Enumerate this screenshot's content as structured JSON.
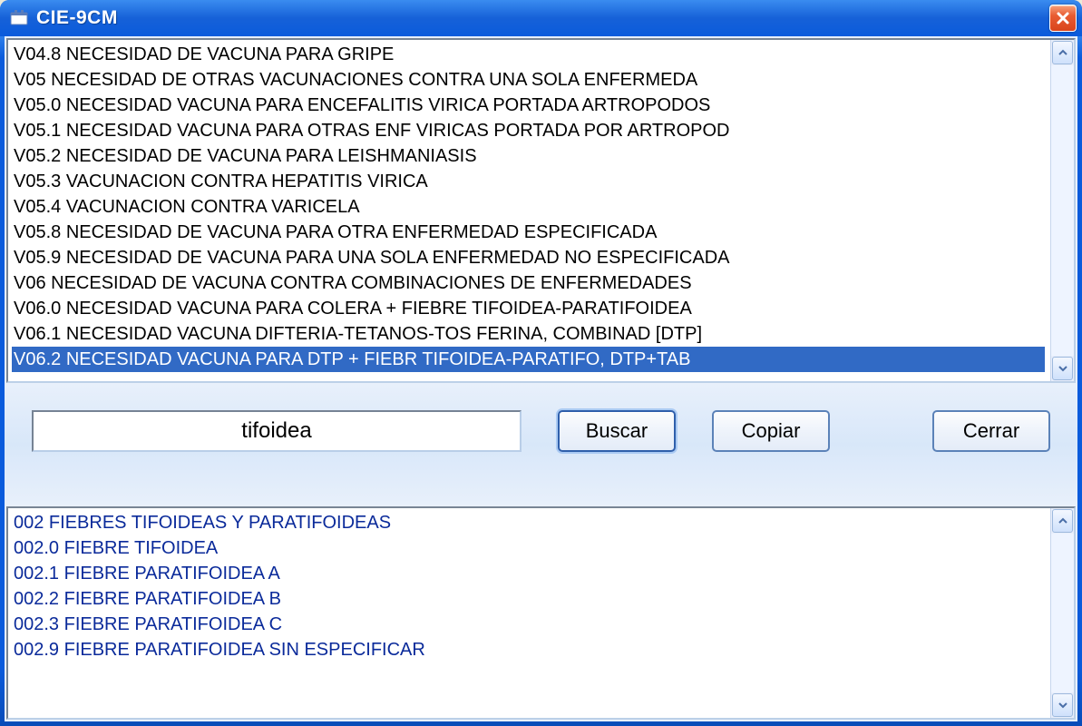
{
  "window": {
    "title": "CIE-9CM"
  },
  "topList": {
    "items": [
      {
        "text": "V04.8 NECESIDAD DE VACUNA PARA GRIPE",
        "selected": false
      },
      {
        "text": "V05 NECESIDAD DE OTRAS VACUNACIONES CONTRA UNA SOLA ENFERMEDA",
        "selected": false
      },
      {
        "text": "V05.0 NECESIDAD VACUNA PARA ENCEFALITIS VIRICA PORTADA ARTROPODOS",
        "selected": false
      },
      {
        "text": "V05.1 NECESIDAD VACUNA PARA OTRAS ENF VIRICAS PORTADA POR ARTROPOD",
        "selected": false
      },
      {
        "text": "V05.2 NECESIDAD DE VACUNA PARA LEISHMANIASIS",
        "selected": false
      },
      {
        "text": "V05.3 VACUNACION CONTRA HEPATITIS VIRICA",
        "selected": false
      },
      {
        "text": "V05.4 VACUNACION CONTRA VARICELA",
        "selected": false
      },
      {
        "text": "V05.8 NECESIDAD DE VACUNA PARA OTRA ENFERMEDAD ESPECIFICADA",
        "selected": false
      },
      {
        "text": "V05.9 NECESIDAD DE VACUNA PARA UNA SOLA ENFERMEDAD NO ESPECIFICADA",
        "selected": false
      },
      {
        "text": "V06 NECESIDAD DE VACUNA CONTRA COMBINACIONES DE ENFERMEDADES",
        "selected": false
      },
      {
        "text": "V06.0 NECESIDAD VACUNA PARA COLERA + FIEBRE TIFOIDEA-PARATIFOIDEA",
        "selected": false
      },
      {
        "text": "V06.1 NECESIDAD VACUNA DIFTERIA-TETANOS-TOS FERINA, COMBINAD [DTP]",
        "selected": false
      },
      {
        "text": "V06.2 NECESIDAD VACUNA PARA DTP + FIEBR TIFOIDEA-PARATIFO, DTP+TAB",
        "selected": true
      }
    ]
  },
  "search": {
    "value": "tifoidea"
  },
  "buttons": {
    "search": "Buscar",
    "copy": "Copiar",
    "close": "Cerrar"
  },
  "bottomList": {
    "items": [
      {
        "text": "002 FIEBRES TIFOIDEAS Y PARATIFOIDEAS"
      },
      {
        "text": "002.0 FIEBRE TIFOIDEA"
      },
      {
        "text": "002.1 FIEBRE PARATIFOIDEA A"
      },
      {
        "text": "002.2 FIEBRE PARATIFOIDEA B"
      },
      {
        "text": "002.3 FIEBRE PARATIFOIDEA C"
      },
      {
        "text": "002.9 FIEBRE PARATIFOIDEA SIN ESPECIFICAR"
      }
    ]
  }
}
